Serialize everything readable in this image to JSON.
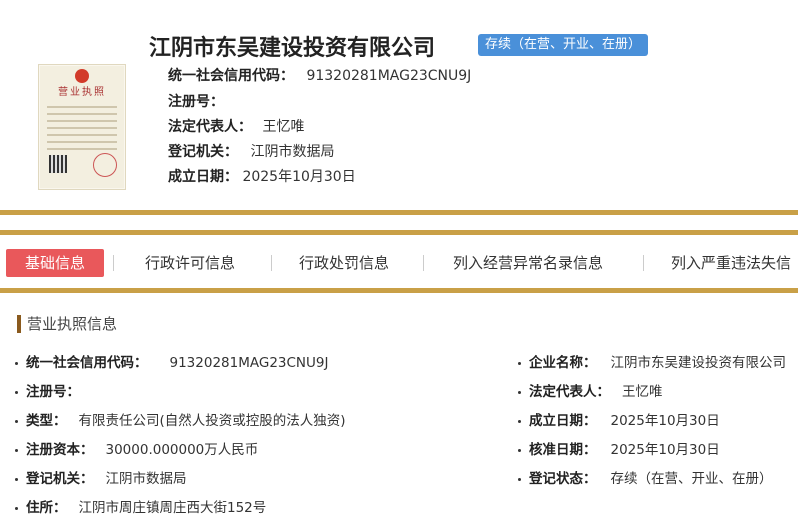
{
  "header": {
    "title": "江阴市东吴建设投资有限公司",
    "status": "存续（在营、开业、在册）",
    "license_label": "营业执照",
    "rows": [
      {
        "k": "统一社会信用代码：",
        "v": "91320281MAG23CNU9J"
      },
      {
        "k": "注册号：",
        "v": ""
      },
      {
        "k": "法定代表人：",
        "v": "王忆唯"
      },
      {
        "k": "登记机关：",
        "v": "江阴市数据局"
      },
      {
        "k": "成立日期：",
        "v": "2025年10月30日"
      }
    ]
  },
  "tabs": [
    {
      "label": "基础信息"
    },
    {
      "label": "行政许可信息"
    },
    {
      "label": "行政处罚信息"
    },
    {
      "label": "列入经营异常名录信息"
    },
    {
      "label": "列入严重违法失信"
    }
  ],
  "section": {
    "title": "营业执照信息",
    "left": [
      {
        "k": "统一社会信用代码：",
        "v": "91320281MAG23CNU9J"
      },
      {
        "k": "注册号：",
        "v": ""
      },
      {
        "k": "类型：",
        "v": "有限责任公司(自然人投资或控股的法人独资)"
      },
      {
        "k": "注册资本：",
        "v": "30000.000000万人民币"
      },
      {
        "k": "登记机关：",
        "v": "江阴市数据局"
      },
      {
        "k": "住所：",
        "v": "江阴市周庄镇周庄西大街152号"
      }
    ],
    "right": [
      {
        "k": "企业名称：",
        "v": "江阴市东吴建设投资有限公司"
      },
      {
        "k": "法定代表人：",
        "v": "王忆唯"
      },
      {
        "k": "成立日期：",
        "v": "2025年10月30日"
      },
      {
        "k": "核准日期：",
        "v": "2025年10月30日"
      },
      {
        "k": "登记状态：",
        "v": "存续（在营、开业、在册）"
      }
    ]
  },
  "colors": {
    "gold": "#c9a047",
    "tab_active": "#e9585b",
    "badge": "#4a90d9",
    "section_bar": "#8a5a1e"
  }
}
